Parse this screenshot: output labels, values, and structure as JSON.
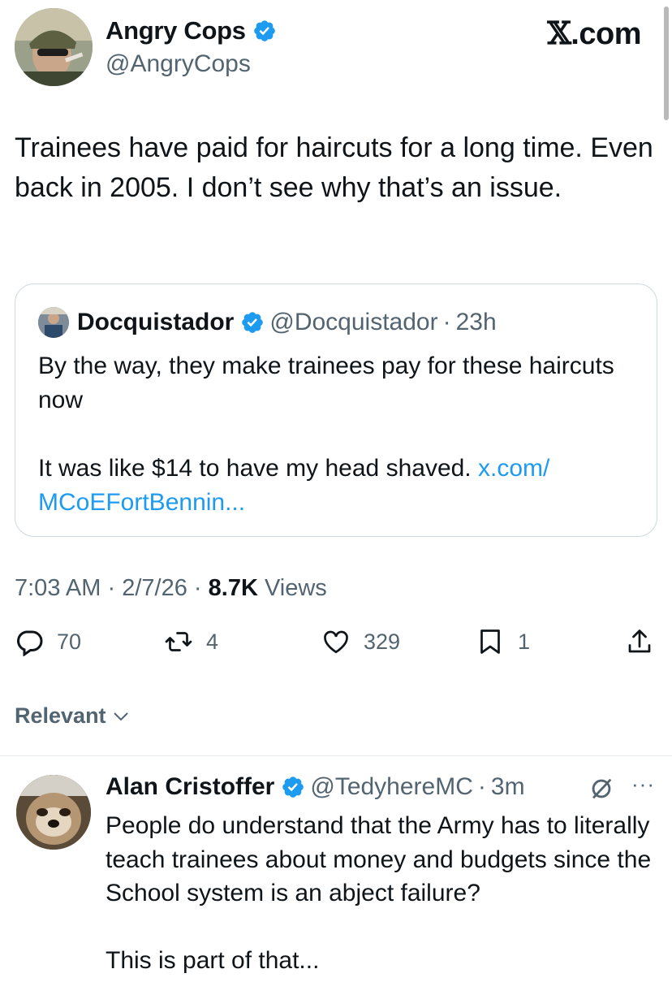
{
  "brand": {
    "label": ".com"
  },
  "tweet": {
    "author_name": "Angry Cops",
    "author_handle": "@AngryCops",
    "text": "Trainees have paid for haircuts for a long time. Even back in 2005. I don’t see why that’s an issue.",
    "time": "7:03 AM",
    "date": "2/7/26",
    "views_count": "8.7K",
    "views_label": "Views",
    "separator": "·"
  },
  "quote": {
    "author_name": "Docquistador",
    "author_handle": "@Docquistador",
    "age": "23h",
    "text_line1": "By the way, they make trainees pay for these haircuts now",
    "text_line2": "It was like $14 to have my head shaved.",
    "link": "x.com/ MCoEFortBennin..."
  },
  "actions": {
    "replies": "70",
    "reposts": "4",
    "likes": "329",
    "bookmarks": "1"
  },
  "sort": {
    "label": "Relevant"
  },
  "reply": {
    "author_name": "Alan Cristoffer",
    "author_handle": "@TedyhereMC",
    "age": "3m",
    "more": "···",
    "text": "People do understand that the Army has to literally teach trainees about money and budgets since the School system is an abject failure?\n\nThis is part of that..."
  },
  "colors": {
    "accent": "#1d9bf0",
    "verified": "#1d9bf0",
    "muted": "#536471",
    "text": "#0f1419"
  },
  "icons": [
    "verified-badge-icon",
    "reply-icon",
    "repost-icon",
    "like-icon",
    "bookmark-icon",
    "share-icon",
    "chevron-down-icon",
    "grok-icon",
    "more-icon"
  ]
}
